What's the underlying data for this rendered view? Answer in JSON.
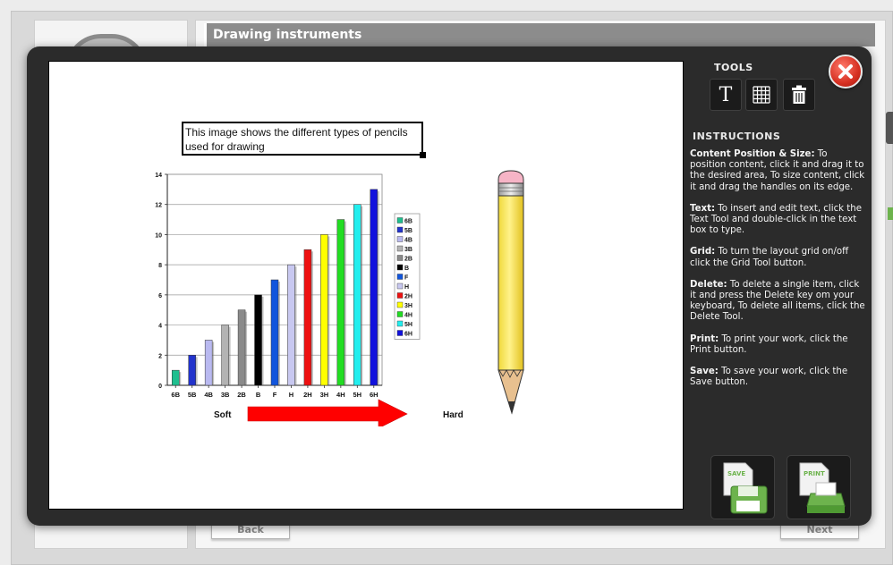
{
  "page": {
    "title": "Drawing instruments",
    "back_label": "Back",
    "next_label": "Next"
  },
  "canvas": {
    "text_box": "This image shows the different types of pencils used for drawing"
  },
  "panel": {
    "tools_label": "TOOLS",
    "tools": [
      {
        "name": "text-tool",
        "icon": "text-T-icon"
      },
      {
        "name": "grid-tool",
        "icon": "grid-icon"
      },
      {
        "name": "delete-tool",
        "icon": "trash-icon"
      }
    ],
    "instructions_label": "INSTRUCTIONS",
    "instructions": [
      {
        "title": "Content Position & Size:",
        "body": "To position content, click it and drag it to the desired area, To size content, click it and drag the handles on its edge."
      },
      {
        "title": "Text:",
        "body": "To insert and edit text, click the Text Tool and double-click in the text box to type."
      },
      {
        "title": "Grid:",
        "body": "To turn the layout grid on/off click the Grid Tool button."
      },
      {
        "title": "Delete:",
        "body": "To delete a single item, click it and press the Delete key om your keyboard, To delete all items, click the Delete Tool."
      },
      {
        "title": "Print:",
        "body": "To print your work, click the Print button."
      },
      {
        "title": "Save:",
        "body": "To save your work, click the Save button."
      }
    ],
    "save_label": "SAVE",
    "print_label": "PRINT"
  },
  "colors": {
    "modal_bg": "#2b2b2b",
    "close_red": "#d63022",
    "arrow_red": "#ff0000"
  },
  "chart_data": {
    "type": "bar",
    "categories": [
      "6B",
      "5B",
      "4B",
      "3B",
      "2B",
      "B",
      "F",
      "H",
      "2H",
      "3H",
      "4H",
      "5H",
      "6H"
    ],
    "values": [
      1,
      2,
      3,
      4,
      5,
      6,
      7,
      8,
      9,
      10,
      11,
      12,
      13
    ],
    "colors": [
      "#1fbf8f",
      "#2233cc",
      "#b9b9f0",
      "#b3b3b3",
      "#8a8a8a",
      "#000000",
      "#1155dd",
      "#c8c8f0",
      "#ee1111",
      "#ffff00",
      "#22dd22",
      "#22eeee",
      "#1111dd"
    ],
    "legend": [
      "6B",
      "5B",
      "4B",
      "3B",
      "2B",
      "B",
      "F",
      "H",
      "2H",
      "3H",
      "4H",
      "5H",
      "6H"
    ],
    "yticks": [
      0,
      2,
      4,
      6,
      8,
      10,
      12,
      14
    ],
    "ylim": [
      0,
      14
    ],
    "grid": true,
    "legend_position": "right",
    "arrow_left_label": "Soft",
    "arrow_right_label": "Hard"
  }
}
